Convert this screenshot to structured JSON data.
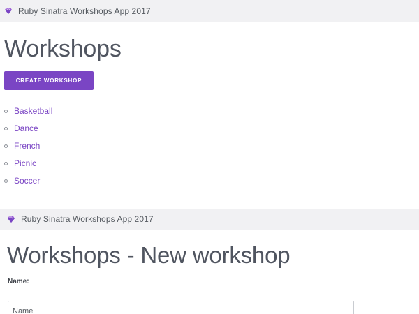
{
  "app": {
    "brand": "Ruby Sinatra Workshops App 2017",
    "accent_color": "#7a45c4",
    "brand_icon": "ruby-gem-icon"
  },
  "index_page": {
    "title": "Workshops",
    "create_button_label": "CREATE WORKSHOP",
    "workshops": [
      "Basketball",
      "Dance",
      "French",
      "Picnic",
      "Soccer"
    ]
  },
  "new_page": {
    "title": "Workshops - New workshop",
    "name_label": "Name:",
    "name_placeholder": "Name",
    "name_value": ""
  }
}
